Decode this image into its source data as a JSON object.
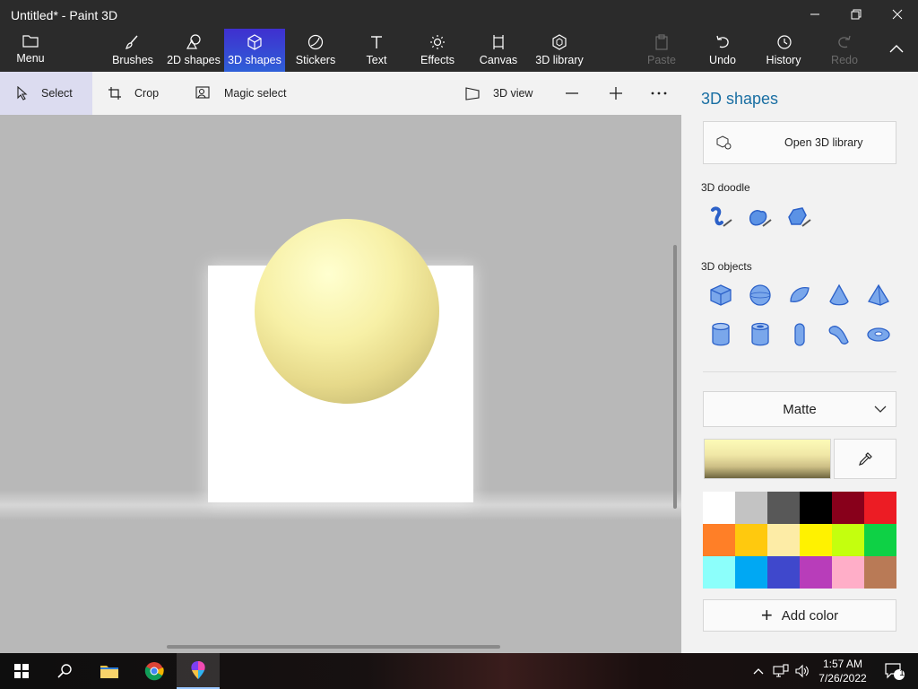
{
  "window": {
    "title": "Untitled* - Paint 3D"
  },
  "ribbon": {
    "tabs": [
      {
        "label": "Menu",
        "icon": "folder-icon"
      },
      {
        "label": "Brushes",
        "icon": "brush-icon"
      },
      {
        "label": "2D shapes",
        "icon": "2d-shapes-icon"
      },
      {
        "label": "3D shapes",
        "icon": "cube-icon",
        "active": true
      },
      {
        "label": "Stickers",
        "icon": "sticker-icon"
      },
      {
        "label": "Text",
        "icon": "text-icon"
      },
      {
        "label": "Effects",
        "icon": "sun-icon"
      },
      {
        "label": "Canvas",
        "icon": "canvas-icon"
      },
      {
        "label": "3D library",
        "icon": "3d-library-icon"
      },
      {
        "label": "Paste",
        "icon": "paste-icon",
        "disabled": true
      },
      {
        "label": "Undo",
        "icon": "undo-icon"
      },
      {
        "label": "History",
        "icon": "history-icon"
      },
      {
        "label": "Redo",
        "icon": "redo-icon",
        "disabled": true
      }
    ]
  },
  "toolbar": {
    "select": "Select",
    "crop": "Crop",
    "magic_select": "Magic select",
    "view_3d": "3D view"
  },
  "panel": {
    "title": "3D shapes",
    "open_library": "Open 3D library",
    "doodle_label": "3D doodle",
    "objects_label": "3D objects",
    "material": "Matte",
    "add_color": "Add color",
    "selected_color": "#f7f0a6",
    "palette": [
      "#ffffff",
      "#c3c3c3",
      "#585858",
      "#000000",
      "#88001b",
      "#ec1c24",
      "#ff7f27",
      "#ffc90e",
      "#fdeca6",
      "#fff200",
      "#c4ff0e",
      "#0ed145",
      "#8cfffb",
      "#00a8f3",
      "#3f48cc",
      "#b83dba",
      "#ffaec8",
      "#b97a56"
    ]
  },
  "taskbar": {
    "time": "1:57 AM",
    "date": "7/26/2022",
    "notification_count": "1"
  }
}
